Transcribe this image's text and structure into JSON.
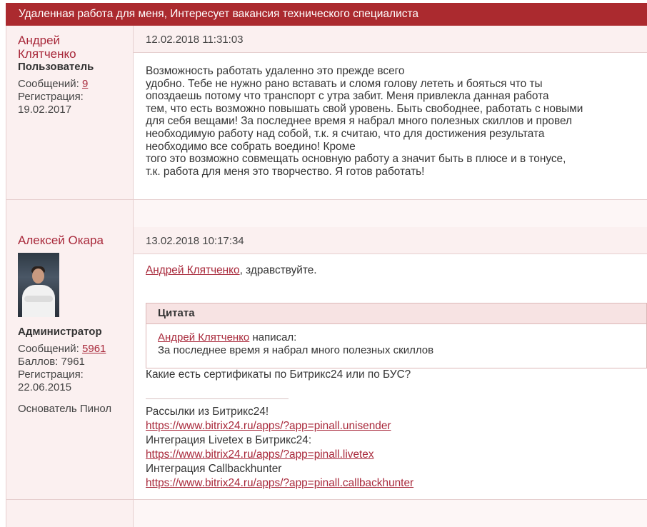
{
  "topic": {
    "title": "Удаленная работа для меня, Интересует вакансия технического специалиста"
  },
  "posts": [
    {
      "author": {
        "name_line1": "Андрей",
        "name_line2": "Клятченко",
        "role": "Пользователь",
        "messages_label": "Сообщений:",
        "messages_count": "9",
        "registration_label": "Регистрация:",
        "registration_date": "19.02.2017"
      },
      "date": "12.02.2018 11:31:03",
      "body_lines": [
        "Возможность работать удаленно это прежде всего",
        "удобно. Тебе не нужно рано вставать и сломя голову лететь и бояться что ты",
        "опоздаешь потому что транспорт с утра забит.  Меня привлекла данная работа",
        "тем, что есть возможно повышать свой уровень. Быть свободнее, работать с новыми",
        "для себя вещами! За последнее время я набрал много полезных скиллов и провел",
        "необходимую работу над собой, т.к. я считаю, что для достижения результата",
        "необходимо все собрать воедино!  Кроме",
        "того это возможно совмещать основную работу а значит быть в плюсе и в тонусе,",
        "т.к. работа для меня это творчество. Я готов работать!"
      ]
    },
    {
      "author": {
        "name": "Алексей Окара",
        "role": "Администратор",
        "messages_label": "Сообщений:",
        "messages_count": "5961",
        "points": "Баллов: 7961",
        "registration_label": "Регистрация:",
        "registration_date": "22.06.2015",
        "title": "Основатель Пинол"
      },
      "date": "13.02.2018 10:17:34",
      "mention": "Андрей Клятченко",
      "greeting": ", здравствуйте.",
      "quote": {
        "header": "Цитата",
        "author": "Андрей Клятченко",
        "wrote": " написал:",
        "text": "За последнее время я набрал много полезных скиллов"
      },
      "question": "Какие есть сертификаты по Битрикс24  или по БУС?",
      "signature": [
        {
          "label": "Рассылки из Битрикс24!",
          "url": "https://www.bitrix24.ru/apps/?app=pinall.unisender"
        },
        {
          "label": "Интеграция Livetex в Битрикс24:",
          "url": "https://www.bitrix24.ru/apps/?app=pinall.livetex"
        },
        {
          "label": "Интеграция Callbackhunter",
          "url": "https://www.bitrix24.ru/apps/?app=pinall.callbackhunter"
        }
      ]
    }
  ]
}
